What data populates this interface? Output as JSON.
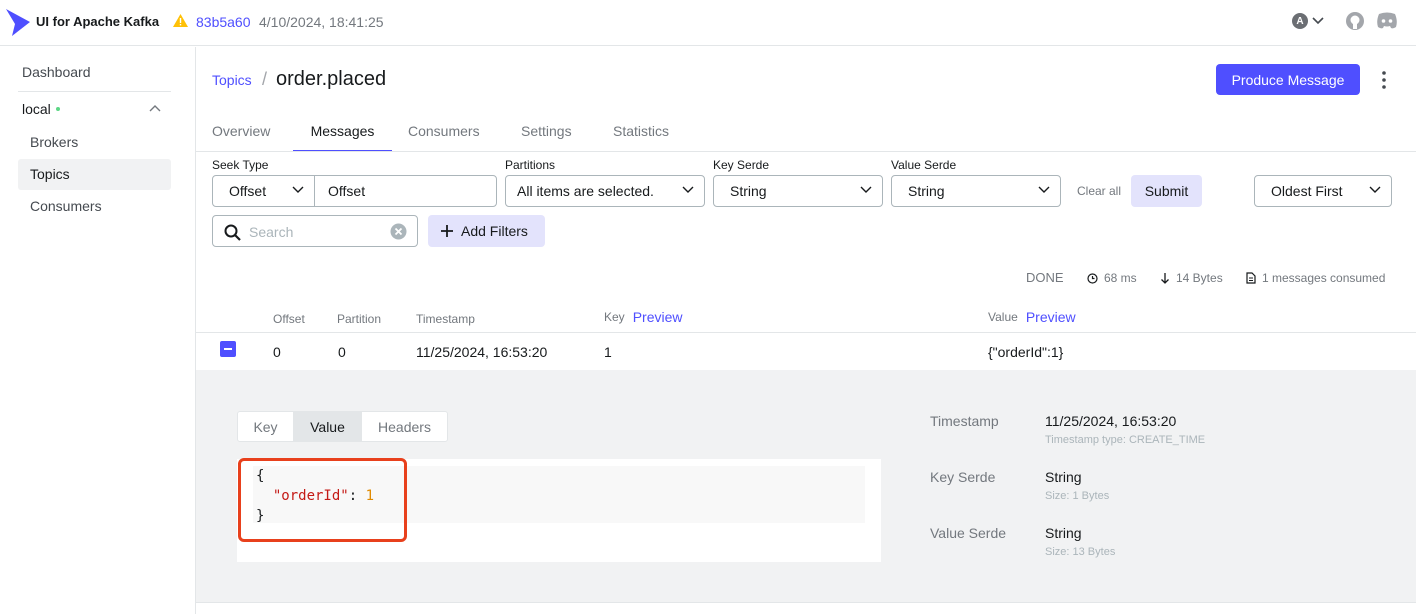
{
  "app": {
    "title": "UI for Apache Kafka",
    "version_hash": "83b5a60",
    "version_date": "4/10/2024, 18:41:25",
    "user_initial": "A",
    "accent": "#4f4fff"
  },
  "sidebar": {
    "dashboard": "Dashboard",
    "cluster": "local",
    "items": [
      {
        "label": "Brokers"
      },
      {
        "label": "Topics"
      },
      {
        "label": "Consumers"
      }
    ]
  },
  "header": {
    "breadcrumb": "Topics",
    "topic": "order.placed",
    "produce_label": "Produce Message"
  },
  "tabs": [
    {
      "label": "Overview"
    },
    {
      "label": "Messages"
    },
    {
      "label": "Consumers"
    },
    {
      "label": "Settings"
    },
    {
      "label": "Statistics"
    }
  ],
  "filters": {
    "seek_type_label": "Seek Type",
    "seek_type_value": "Offset",
    "offset_value": "Offset",
    "partitions_label": "Partitions",
    "partitions_value": "All items are selected.",
    "key_serde_label": "Key Serde",
    "key_serde_value": "String",
    "value_serde_label": "Value Serde",
    "value_serde_value": "String",
    "clear_all": "Clear all",
    "submit": "Submit",
    "sort_value": "Oldest First",
    "search_placeholder": "Search",
    "add_filters": "Add Filters"
  },
  "stats": {
    "status": "DONE",
    "time": "68 ms",
    "bytes": "14 Bytes",
    "consumed": "1 messages consumed"
  },
  "table": {
    "headers": {
      "offset": "Offset",
      "partition": "Partition",
      "timestamp": "Timestamp",
      "key": "Key",
      "value": "Value",
      "preview": "Preview"
    },
    "rows": [
      {
        "offset": "0",
        "partition": "0",
        "timestamp": "11/25/2024, 16:53:20",
        "key": "1",
        "value": "{\"orderId\":1}"
      }
    ]
  },
  "detail": {
    "tabs": [
      {
        "label": "Key"
      },
      {
        "label": "Value"
      },
      {
        "label": "Headers"
      }
    ],
    "json": {
      "open": "{",
      "key": "\"orderId\"",
      "colon": ": ",
      "value": "1",
      "close": "}"
    },
    "meta": {
      "timestamp_label": "Timestamp",
      "timestamp_value": "11/25/2024, 16:53:20",
      "timestamp_type": "Timestamp type: CREATE_TIME",
      "key_serde_label": "Key Serde",
      "key_serde_value": "String",
      "key_size": "Size: 1 Bytes",
      "value_serde_label": "Value Serde",
      "value_serde_value": "String",
      "value_size": "Size: 13 Bytes"
    }
  }
}
